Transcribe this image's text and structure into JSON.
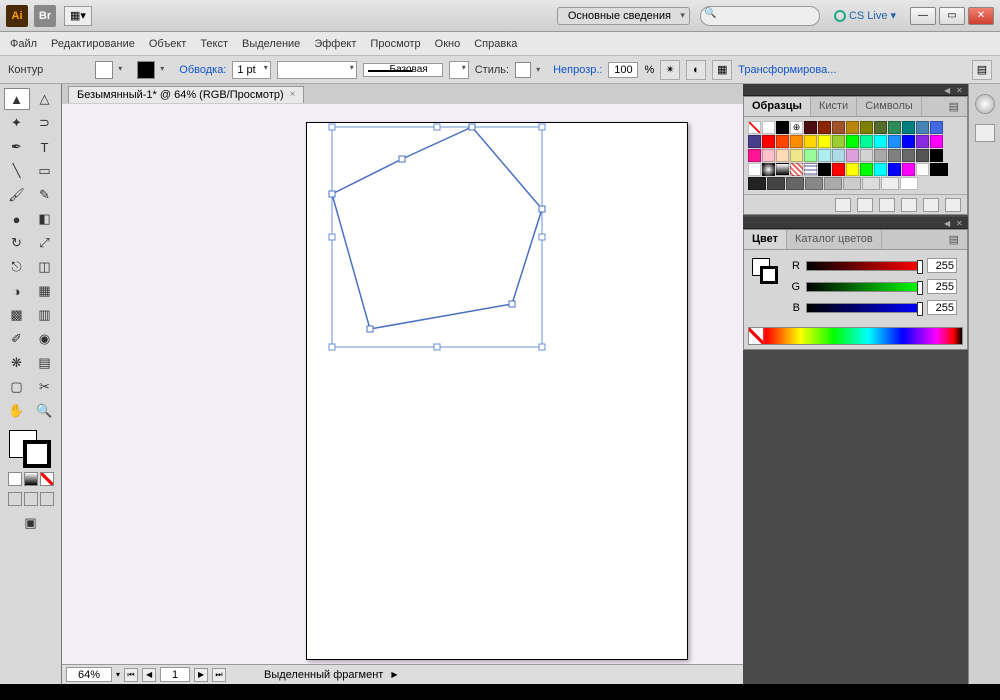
{
  "titlebar": {
    "ai": "Ai",
    "br": "Br",
    "workspace": "Основные сведения",
    "cslive": "CS Live"
  },
  "menu": {
    "file": "Файл",
    "edit": "Редактирование",
    "object": "Объект",
    "text": "Текст",
    "select": "Выделение",
    "effect": "Эффект",
    "view": "Просмотр",
    "window": "Окно",
    "help": "Справка"
  },
  "control": {
    "mode": "Контур",
    "stroke_label": "Обводка:",
    "stroke_pt": "1 pt",
    "brush_label": "Базовая",
    "style_label": "Стиль:",
    "opacity_label": "Непрозр.:",
    "opacity_value": "100",
    "percent": "%",
    "transform": "Трансформирова..."
  },
  "doc": {
    "tab": "Безымянный-1* @ 64% (RGB/Просмотр)"
  },
  "status": {
    "zoom": "64%",
    "page": "1",
    "info": "Выделенный фрагмент"
  },
  "panels": {
    "swatches": {
      "title": "Образцы",
      "tab2": "Кисти",
      "tab3": "Символы"
    },
    "color": {
      "title": "Цвет",
      "tab2": "Каталог цветов",
      "r": "R",
      "g": "G",
      "b": "B",
      "rv": "255",
      "gv": "255",
      "bv": "255"
    }
  },
  "swatch_colors": [
    "none",
    "#ffffff",
    "#000000",
    "reg",
    "#4b0f0f",
    "#8b2500",
    "#a0522d",
    "#b8860b",
    "#808000",
    "#556b2f",
    "#2e8b57",
    "#008080",
    "#4682b4",
    "#4169e1",
    "#483d8b",
    "#ff0000",
    "#ff4500",
    "#ff8c00",
    "#ffd700",
    "#ffff00",
    "#9acd32",
    "#00ff00",
    "#00fa9a",
    "#00ffff",
    "#1e90ff",
    "#0000ff",
    "#8a2be2",
    "#ff00ff",
    "#ff1493",
    "#ffc0cb",
    "#ffdab9",
    "#f0e68c",
    "#98fb98",
    "#afeeee",
    "#add8e6",
    "#dda0dd",
    "#d3d3d3",
    "#a9a9a9",
    "#808080",
    "#696969",
    "#555",
    "#000",
    "#fff",
    "rad",
    "lin",
    "pat1",
    "pat2",
    "#000000",
    "#ff0000",
    "#ffff00",
    "#00ff00",
    "#00ffff",
    "#0000ff",
    "#ff00ff",
    "#ffffff",
    "g1",
    "g2",
    "g3",
    "g4",
    "g5",
    "g6",
    "g7",
    "g8",
    "g9",
    "g10"
  ]
}
